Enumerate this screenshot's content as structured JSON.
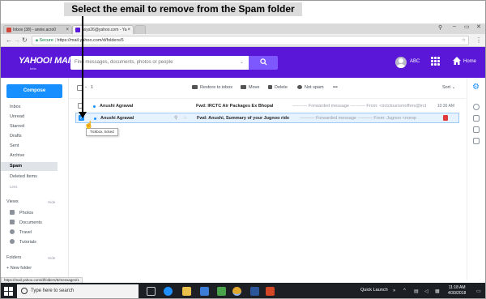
{
  "annotation": "Select the email to remove from the Spam folder",
  "browser": {
    "tabs": [
      {
        "label": "Inbox (38) - annie.acro0"
      },
      {
        "label": "axys26@yahoo.com - Ya"
      }
    ],
    "secure_label": "Secure",
    "url": "https://mail.yahoo.com/d/folders/6"
  },
  "header": {
    "logo": "YAHOO! MAIL",
    "logo_sub": "beta",
    "search_placeholder": "Find messages, documents, photos or people",
    "user": "ABC",
    "home_label": "Home"
  },
  "sidebar": {
    "compose": "Compose",
    "folders": [
      {
        "label": "Inbox"
      },
      {
        "label": "Unread"
      },
      {
        "label": "Starred"
      },
      {
        "label": "Drafts"
      },
      {
        "label": "Sent"
      },
      {
        "label": "Archive"
      },
      {
        "label": "Spam"
      },
      {
        "label": "Deleted Items"
      },
      {
        "label": "Less"
      }
    ],
    "views_title": "Views",
    "views_hide": "Hide",
    "views": [
      {
        "label": "Photos"
      },
      {
        "label": "Documents"
      },
      {
        "label": "Travel"
      },
      {
        "label": "Tutorials"
      }
    ],
    "folders_title": "Folders",
    "folders_hide": "Hide",
    "new_folder": "+ New folder"
  },
  "toolbar": {
    "count": "1",
    "restore": "Restore to inbox",
    "move": "Move",
    "delete": "Delete",
    "not_spam": "Not spam",
    "more": "•••",
    "sort": "Sort"
  },
  "messages": [
    {
      "sender": "Anushi Agrawal",
      "subject": "Fwd: IRCTC Air Packages Ex Bhopal",
      "snippet": "---------- Forwarded message ---------- From: <irctctourismoffers@irct",
      "time": "10:36 AM"
    },
    {
      "sender": "Anushi Agrawal",
      "subject": "Fwd: Anushi, Summary of your Jugnoo ride",
      "snippet": "---------- Forwarded message ---------- From: Jugnoo <norep"
    }
  ],
  "tooltip": "Tickbox, ticked",
  "status_url": "https://mail.yahoo.com/d/folders/6/messages/1",
  "taskbar": {
    "search_placeholder": "Type here to search",
    "quick_launch": "Quick Launch",
    "time": "11:18 AM",
    "date": "4/30/2018"
  },
  "colors": {
    "yahoo_purple": "#5a17d8",
    "search_button": "#7d58ff",
    "compose_blue": "#188fff",
    "selected_row": "#e6f2ff"
  }
}
